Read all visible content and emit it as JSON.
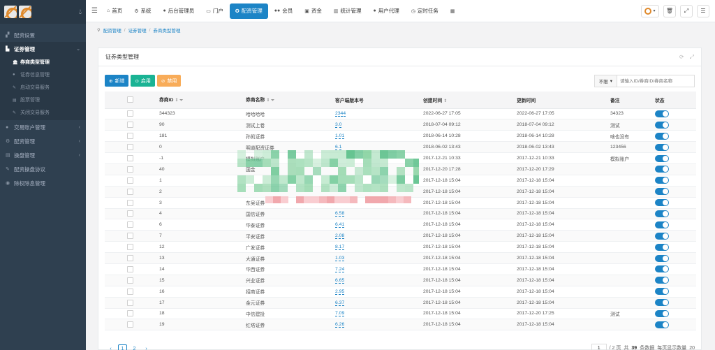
{
  "sidebar": {
    "items": [
      {
        "icon": "chart-icon",
        "label": "配资设置",
        "arrow": ""
      },
      {
        "icon": "bar-chart-icon",
        "label": "证券管理",
        "arrow": "⌄",
        "active": true
      },
      {
        "icon": "user-icon",
        "label": "交易账户管理",
        "arrow": "‹"
      },
      {
        "icon": "gear-icon",
        "label": "配资管理",
        "arrow": "‹"
      },
      {
        "icon": "list-icon",
        "label": "操盘管理",
        "arrow": "‹"
      },
      {
        "icon": "edit-icon",
        "label": "配资操盘协议",
        "arrow": ""
      },
      {
        "icon": "shield-icon",
        "label": "除权除息管理",
        "arrow": ""
      }
    ],
    "sub_items": [
      {
        "label": "券商类型管理",
        "active": true
      },
      {
        "label": "证券信息管理"
      },
      {
        "label": "启动交易服务"
      },
      {
        "label": "股票管理"
      },
      {
        "label": "关闭交易服务"
      }
    ]
  },
  "topbar": {
    "tabs": [
      {
        "icon": "home-icon",
        "glyph": "⌂",
        "label": "首页"
      },
      {
        "icon": "gear-icon",
        "glyph": "⚙",
        "label": "系统"
      },
      {
        "icon": "user-icon",
        "glyph": "●",
        "label": "后台管理员"
      },
      {
        "icon": "window-icon",
        "glyph": "▭",
        "label": "门户"
      },
      {
        "icon": "cog-icon",
        "glyph": "✪",
        "label": "配资管理",
        "active": true
      },
      {
        "icon": "users-icon",
        "glyph": "●●",
        "label": "会员"
      },
      {
        "icon": "money-icon",
        "glyph": "▣",
        "label": "资金"
      },
      {
        "icon": "stats-icon",
        "glyph": "▥",
        "label": "统计管理"
      },
      {
        "icon": "agent-icon",
        "glyph": "●",
        "label": "用户代理"
      },
      {
        "icon": "clock-icon",
        "glyph": "◷",
        "label": "定时任务"
      },
      {
        "icon": "grid-icon",
        "glyph": "▦",
        "label": ""
      }
    ]
  },
  "breadcrumb": [
    "配资管理",
    "证券管理",
    "券商类型管理"
  ],
  "panel": {
    "title": "证券类型管理",
    "buttons": {
      "add": "新增",
      "enable": "启用",
      "disable": "禁用"
    },
    "filter_select": "不限",
    "filter_placeholder": "请输入ID/券商ID/券商名称"
  },
  "table": {
    "headers": [
      "券商ID",
      "券商名称",
      "客户端版本号",
      "创建时间",
      "更新时间",
      "备注",
      "状态"
    ],
    "rows": [
      [
        "344323",
        "哈哈哈哈",
        "2344",
        "2022-06-27 17:05",
        "2022-06-27 17:05",
        "34323"
      ],
      [
        "90",
        "测试上卷",
        "3.0",
        "2018-07-04 09:12",
        "2018-07-04 09:12",
        "测试"
      ],
      [
        "181",
        "孙凯证券",
        "1.01",
        "2018-06-14 10:28",
        "2018-06-14 10:28",
        "啥也没有"
      ],
      [
        "0",
        "明道配资证券",
        "6.1",
        "2018-06-02 13:43",
        "2018-06-02 13:43",
        "123456"
      ],
      [
        "-1",
        "模拟账户",
        "",
        "2017-12-21 10:33",
        "2017-12-21 10:33",
        "模拟账户"
      ],
      [
        "40",
        "国金",
        "",
        "2017-12-20 17:28",
        "2017-12-20 17:29",
        ""
      ],
      [
        "1",
        "",
        "",
        "2017-12-18 15:04",
        "2017-12-18 15:04",
        ""
      ],
      [
        "2",
        "",
        "",
        "2017-12-18 15:04",
        "2017-12-18 15:04",
        ""
      ],
      [
        "3",
        "东吴证券",
        "",
        "2017-12-18 15:04",
        "2017-12-18 15:04",
        ""
      ],
      [
        "4",
        "国信证券",
        "6.58",
        "2017-12-18 15:04",
        "2017-12-18 15:04",
        ""
      ],
      [
        "6",
        "华泰证券",
        "6.41",
        "2017-12-18 15:04",
        "2017-12-18 15:04",
        ""
      ],
      [
        "7",
        "平安证券",
        "2.08",
        "2017-12-18 15:04",
        "2017-12-18 15:04",
        ""
      ],
      [
        "12",
        "广发证券",
        "8.17",
        "2017-12-18 15:04",
        "2017-12-18 15:04",
        ""
      ],
      [
        "13",
        "大通证券",
        "1.03",
        "2017-12-18 15:04",
        "2017-12-18 15:04",
        ""
      ],
      [
        "14",
        "华西证券",
        "7.24",
        "2017-12-18 15:04",
        "2017-12-18 15:04",
        ""
      ],
      [
        "15",
        "兴业证券",
        "6.65",
        "2017-12-18 15:04",
        "2017-12-18 15:04",
        ""
      ],
      [
        "16",
        "招商证券",
        "2.95",
        "2017-12-18 15:04",
        "2017-12-18 15:04",
        ""
      ],
      [
        "17",
        "金元证券",
        "6.37",
        "2017-12-18 15:04",
        "2017-12-18 15:04",
        ""
      ],
      [
        "18",
        "中信建投",
        "7.09",
        "2017-12-18 15:04",
        "2017-12-20 17:25",
        "测试"
      ],
      [
        "19",
        "红塔证券",
        "6.26",
        "2017-12-18 15:04",
        "2017-12-18 15:04",
        ""
      ]
    ]
  },
  "pager": {
    "prev": "‹",
    "pages": [
      "1",
      "2"
    ],
    "next": "›",
    "current_page": "1",
    "total_pages_text": "/ 2 页",
    "total_prefix": "共",
    "total_count": "39",
    "total_suffix": "条数据",
    "per_page_label": "每页显示数量",
    "per_page": "20"
  },
  "colors": {
    "sidebar_bg": "#2f4050",
    "primary": "#1c84c6",
    "success": "#1ab394",
    "warning": "#f8ac59"
  }
}
